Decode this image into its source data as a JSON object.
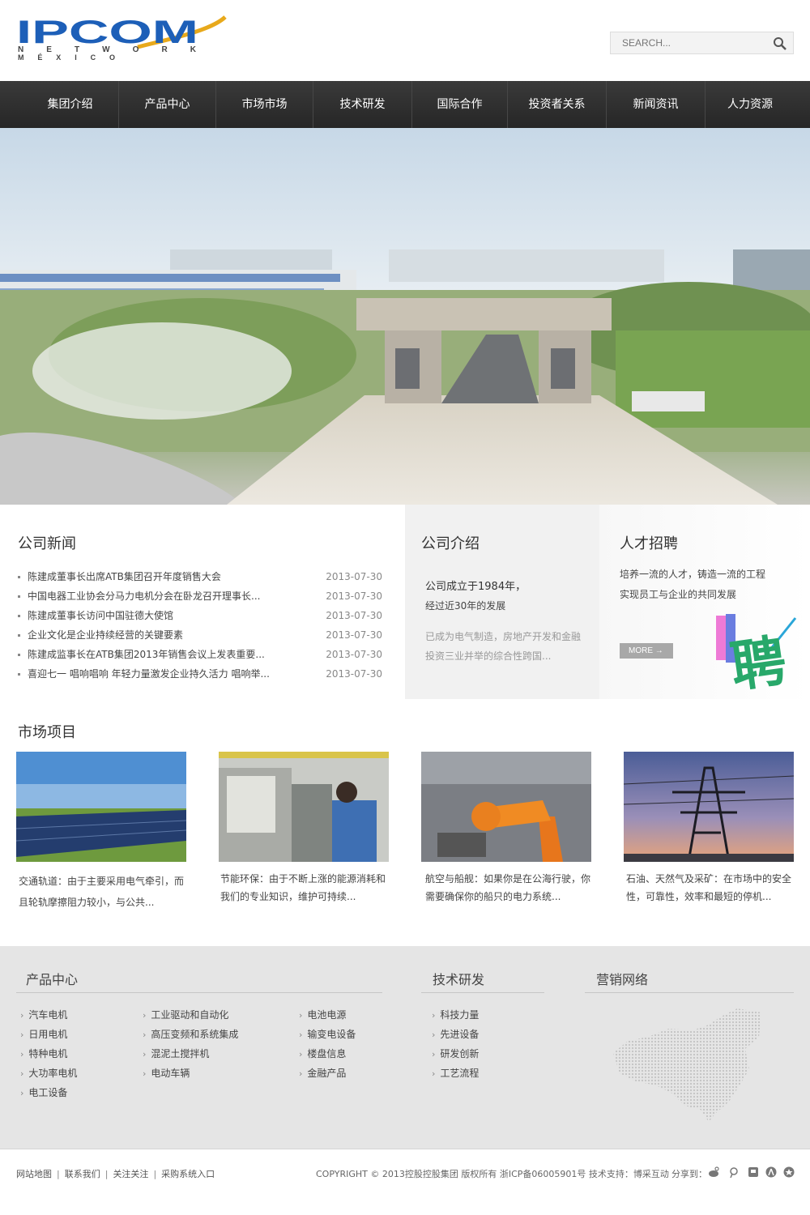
{
  "brand": {
    "name": "IPCOM",
    "line2": "N E T W O R K",
    "line3": "M É X I C O",
    "color_primary": "#1d5fb8",
    "color_accent": "#e8a91b"
  },
  "search": {
    "placeholder": "SEARCH..."
  },
  "nav": {
    "items": [
      "集团介绍",
      "产品中心",
      "市场市场",
      "技术研发",
      "国际合作",
      "投资者关系",
      "新闻资讯",
      "人力资源"
    ]
  },
  "news": {
    "title": "公司新闻",
    "items": [
      {
        "text": "陈建成董事长出席ATB集团召开年度销售大会",
        "date": "2013-07-30"
      },
      {
        "text": "中国电器工业协会分马力电机分会在卧龙召开理事长...",
        "date": "2013-07-30"
      },
      {
        "text": "陈建成董事长访问中国驻德大使馆",
        "date": "2013-07-30"
      },
      {
        "text": "企业文化是企业持续经营的关键要素",
        "date": "2013-07-30"
      },
      {
        "text": "陈建成监事长在ATB集团2013年销售会议上发表重要...",
        "date": "2013-07-30"
      },
      {
        "text": "喜迎七一 唱响唱响 年轻力量激发企业持久活力 唱响举...",
        "date": "2013-07-30"
      }
    ]
  },
  "intro": {
    "title": "公司介绍",
    "line1": "公司成立于1984年，",
    "line2": "经过近30年的发展",
    "desc1": "已成为电气制造，房地产开发和金融",
    "desc2": "投资三业并举的综合性跨国..."
  },
  "recruit": {
    "title": "人才招聘",
    "line1": "培养一流的人才，铸造一流的工程",
    "line2": "实现员工与企业的共同发展",
    "more": "MORE",
    "more_arrow": "→",
    "graphic_char": "聘"
  },
  "market": {
    "title": "市场项目",
    "items": [
      {
        "line1": "交通轨道：由于主要采用电气牵引，而",
        "line2": "且轮轨摩擦阻力较小，与公共..."
      },
      {
        "line1": "节能环保：由于不断上涨的能源消耗和",
        "line2": "我们的专业知识，维护可持续..."
      },
      {
        "line1": "航空与船舰：如果你是在公海行驶，你",
        "line2": "需要确保你的船只的电力系统..."
      },
      {
        "line1": "石油、天然气及采矿：在市场中的安全",
        "line2": "性，可靠性，效率和最短的停机..."
      }
    ]
  },
  "footer": {
    "products_title": "产品中心",
    "products_col1": [
      "汽车电机",
      "日用电机",
      "特种电机",
      "大功率电机",
      "电工设备"
    ],
    "products_col2": [
      "工业驱动和自动化",
      "高压变频和系统集成",
      "混泥土搅拌机",
      "电动车辆"
    ],
    "products_col3": [
      "电池电源",
      "输变电设备",
      "楼盘信息",
      "金融产品"
    ],
    "tech_title": "技术研发",
    "tech_items": [
      "科技力量",
      "先进设备",
      "研发创新",
      "工艺流程"
    ],
    "network_title": "营销网络",
    "arrow": "›",
    "bottom_links": [
      "网站地图",
      "联系我们",
      "关注关注",
      "采购系统入口"
    ],
    "separator": "|",
    "copyright": "COPYRIGHT © 2013控股控股集团 版权所有 浙ICP备06005901号 技术支持：博采互动",
    "share_label": "分享到：",
    "share_icons": [
      "weibo-icon",
      "tencent-weibo-icon",
      "douban-icon",
      "renren-icon",
      "kaixin-icon"
    ]
  }
}
